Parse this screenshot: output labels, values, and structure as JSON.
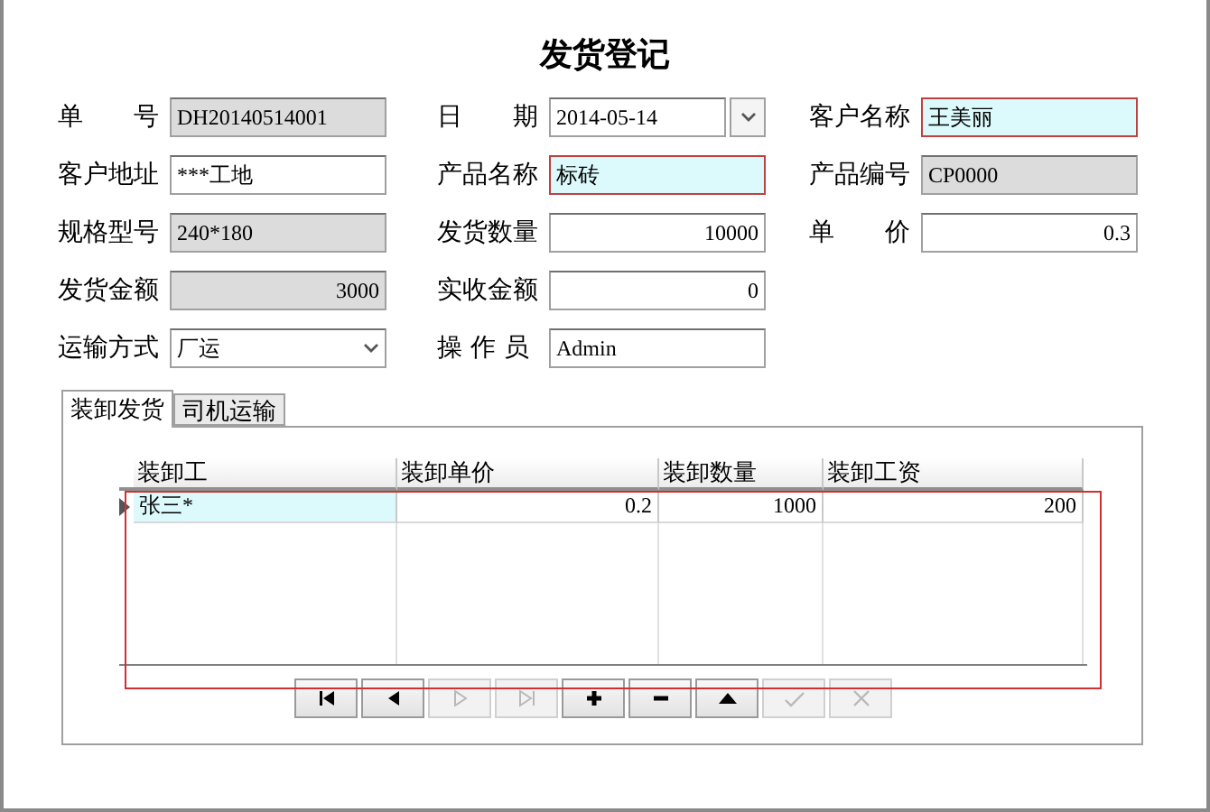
{
  "title": "发货登记",
  "fields": [
    {
      "label": "单　　号",
      "value": "DH20140514001",
      "kind": "readonly"
    },
    {
      "label": "日　　期",
      "value": "2014-05-14",
      "kind": "date"
    },
    {
      "label": "客户名称",
      "value": "王美丽",
      "kind": "required"
    },
    {
      "label": "客户地址",
      "value": "***工地",
      "kind": "text"
    },
    {
      "label": "产品名称",
      "value": "标砖",
      "kind": "required"
    },
    {
      "label": "产品编号",
      "value": "CP0000",
      "kind": "readonly"
    },
    {
      "label": "规格型号",
      "value": "240*180",
      "kind": "readonly"
    },
    {
      "label": "发货数量",
      "value": "10000",
      "kind": "number"
    },
    {
      "label": "单　　价",
      "value": "0.3",
      "kind": "number"
    },
    {
      "label": "发货金额",
      "value": "3000",
      "kind": "readonly-number"
    },
    {
      "label": "实收金额",
      "value": "0",
      "kind": "number"
    },
    {
      "kind": "empty"
    },
    {
      "label": "运输方式",
      "value": "厂运",
      "kind": "select"
    },
    {
      "label": "操 作 员",
      "value": "Admin",
      "kind": "text"
    }
  ],
  "tabs": [
    {
      "label": "装卸发货",
      "selected": true
    },
    {
      "label": "司机运输",
      "selected": false
    }
  ],
  "grid": {
    "columns": [
      "装卸工",
      "装卸单价",
      "装卸数量",
      "装卸工资"
    ],
    "rows": [
      {
        "selected": true,
        "cells": [
          "张三*",
          "0.2",
          "1000",
          "200"
        ]
      }
    ]
  },
  "navigator": [
    {
      "kind": "first",
      "disabled": false
    },
    {
      "kind": "prior",
      "disabled": false
    },
    {
      "kind": "next",
      "disabled": true
    },
    {
      "kind": "last",
      "disabled": true
    },
    {
      "kind": "insert",
      "disabled": false
    },
    {
      "kind": "delete",
      "disabled": false
    },
    {
      "kind": "edit",
      "disabled": false
    },
    {
      "kind": "post",
      "disabled": true
    },
    {
      "kind": "cancel",
      "disabled": true
    }
  ]
}
